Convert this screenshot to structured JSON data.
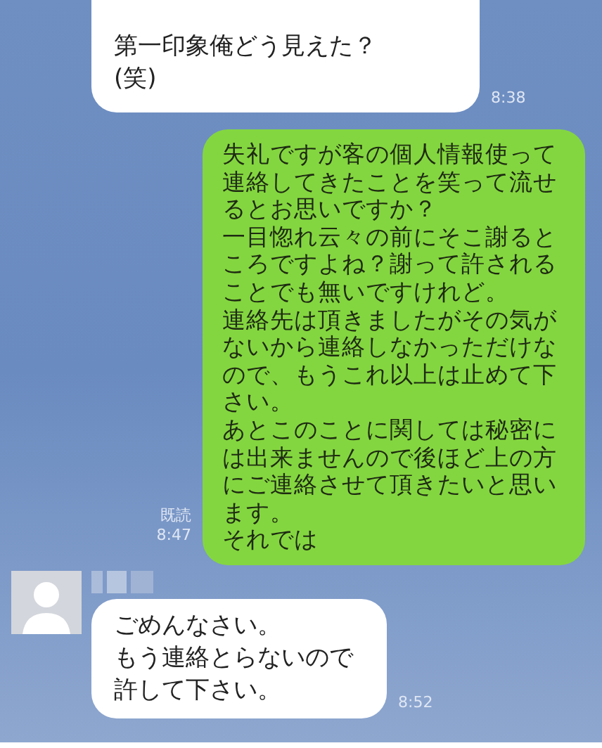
{
  "messages": [
    {
      "kind": "incoming",
      "lines": [
        "第一印象俺どう見えた？",
        "(笑)"
      ],
      "time": "8:38",
      "avatar": false,
      "cut_top": true
    },
    {
      "kind": "outgoing",
      "lines": [
        "失礼ですが客の個人情報使って",
        "連絡してきたことを笑って流せ",
        "るとお思いですか？",
        "一目惚れ云々の前にそこ謝ると",
        "ころですよね？謝って許される",
        "ことでも無いですけれど。",
        "連絡先は頂きましたがその気が",
        "ないから連絡しなかっただけな",
        "ので、もうこれ以上は止めて下",
        "さい。",
        "あとこのことに関しては秘密に",
        "は出来ませんので後ほど上の方",
        "にご連絡させて頂きたいと思い",
        "ます。",
        "それでは"
      ],
      "time": "8:47",
      "read": "既読"
    },
    {
      "kind": "incoming",
      "lines": [
        "ごめんなさい。",
        "もう連絡とらないので",
        "許して下さい。"
      ],
      "time": "8:52",
      "avatar": true,
      "cut_top": false
    }
  ]
}
